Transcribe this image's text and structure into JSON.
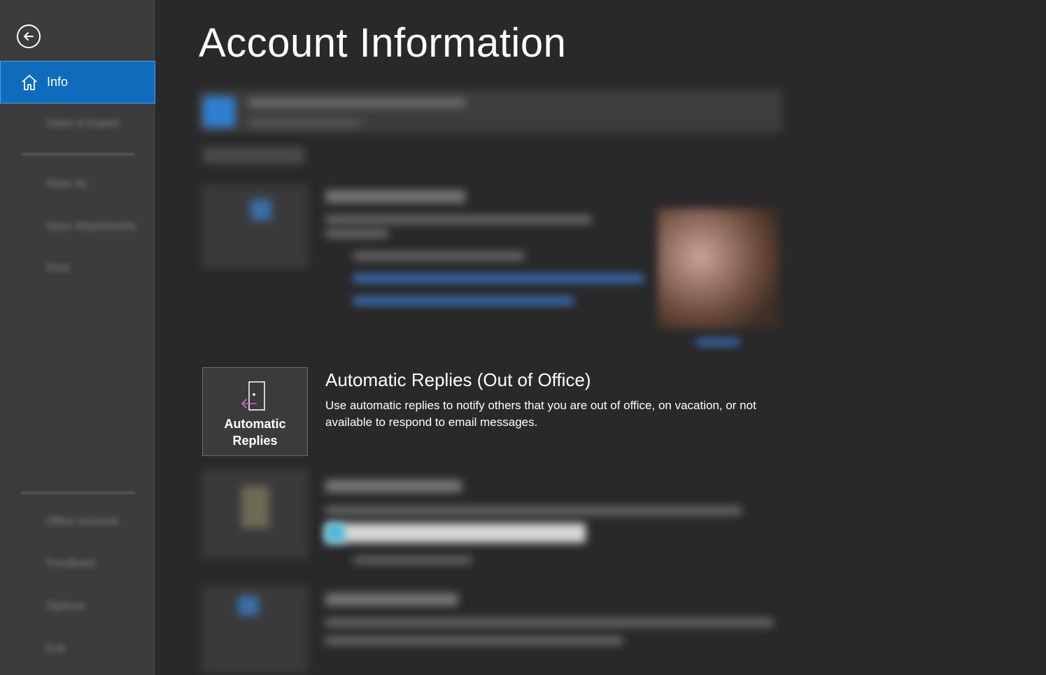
{
  "sidebar": {
    "back_label": "Back",
    "info_label": "Info",
    "items_top": [
      "Open & Export"
    ],
    "items_mid": [
      "Save As",
      "Save Attachments",
      "Print"
    ],
    "items_bottom": [
      "Office Account",
      "Feedback",
      "Options",
      "Exit"
    ]
  },
  "main": {
    "title": "Account Information",
    "auto_replies": {
      "button_label_line1": "Automatic",
      "button_label_line2": "Replies",
      "heading": "Automatic Replies (Out of Office)",
      "description": "Use automatic replies to notify others that you are out of office, on vacation, or not available to respond to email messages."
    }
  },
  "colors": {
    "accent": "#0f6cbd",
    "sidebar_bg": "#3c3c3c",
    "main_bg": "#292929",
    "icon_accent": "#c86ad4"
  }
}
